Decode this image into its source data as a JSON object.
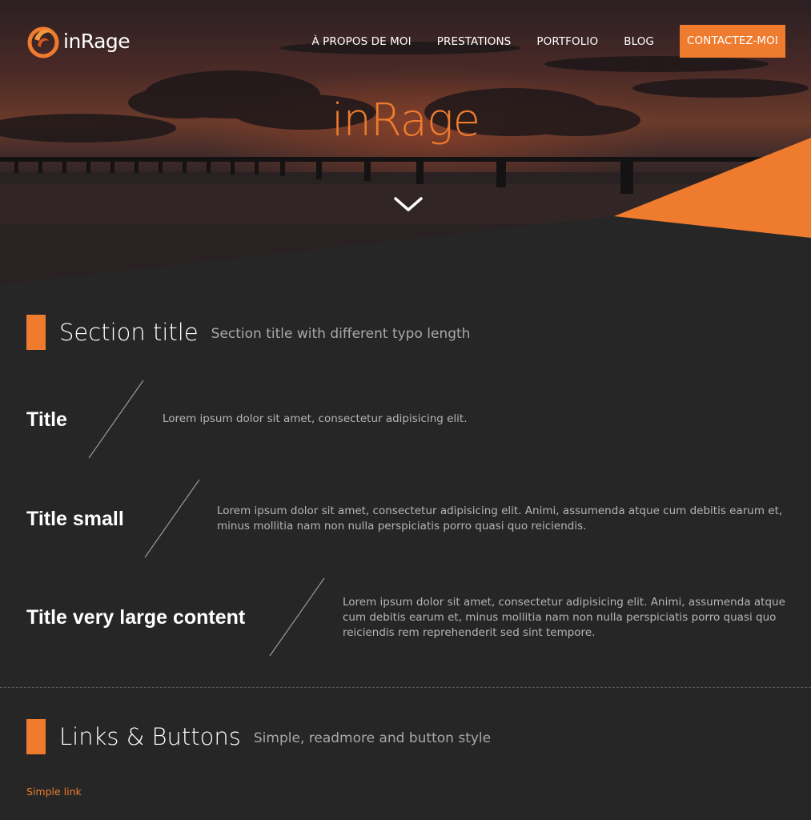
{
  "brand": {
    "logo_text": "inRage",
    "accent_color": "#ef7c2e"
  },
  "nav": {
    "items": [
      {
        "label": "À PROPOS DE MOI"
      },
      {
        "label": "PRESTATIONS"
      },
      {
        "label": "PORTFOLIO"
      },
      {
        "label": "BLOG"
      }
    ],
    "cta_label": "CONTACTEZ-MOI"
  },
  "hero": {
    "title": "inRage",
    "scroll_icon": "chevron-down-icon"
  },
  "section1": {
    "title": "Section title",
    "subtitle": "Section title with different typo length",
    "rows": [
      {
        "title": "Title",
        "text": "Lorem ipsum dolor sit amet, consectetur adipisicing elit."
      },
      {
        "title": "Title small",
        "text": "Lorem ipsum dolor sit amet, consectetur adipisicing elit. Animi, assumenda atque cum debitis earum et, minus mollitia nam non nulla perspiciatis porro quasi quo reiciendis."
      },
      {
        "title": "Title very large content",
        "text": "Lorem ipsum dolor sit amet, consectetur adipisicing elit. Animi, assumenda atque cum debitis earum et, minus mollitia nam non nulla perspiciatis porro quasi quo reiciendis rem reprehenderit sed sint tempore."
      }
    ]
  },
  "section2": {
    "title": "Links & Buttons",
    "subtitle": "Simple, readmore and button style",
    "simple_link": "Simple link"
  }
}
